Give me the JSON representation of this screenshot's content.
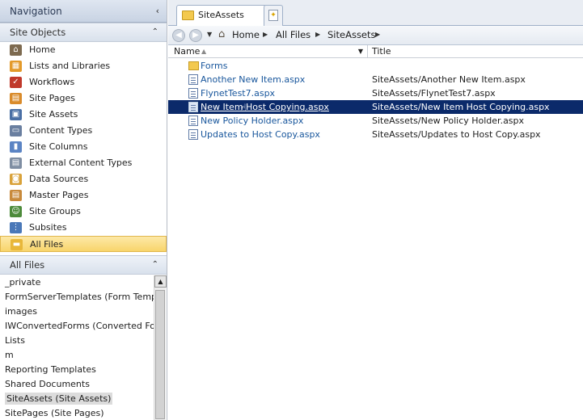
{
  "navigation": {
    "title": "Navigation",
    "collapse_glyph": "‹"
  },
  "site_objects": {
    "title": "Site Objects",
    "collapse_glyph": "⌃",
    "items": [
      {
        "label": "Home",
        "icon": "home-icon",
        "color": "#7d6a50",
        "glyph": "⌂"
      },
      {
        "label": "Lists and Libraries",
        "icon": "lists-icon",
        "color": "#e39a2a",
        "glyph": "▦"
      },
      {
        "label": "Workflows",
        "icon": "workflow-icon",
        "color": "#c0392b",
        "glyph": "✓"
      },
      {
        "label": "Site Pages",
        "icon": "site-pages-icon",
        "color": "#d98b2b",
        "glyph": "▤"
      },
      {
        "label": "Site Assets",
        "icon": "site-assets-icon",
        "color": "#4a6fa5",
        "glyph": "▣"
      },
      {
        "label": "Content Types",
        "icon": "content-types-icon",
        "color": "#6a7fa0",
        "glyph": "▭"
      },
      {
        "label": "Site Columns",
        "icon": "site-columns-icon",
        "color": "#5b84c4",
        "glyph": "▮"
      },
      {
        "label": "External Content Types",
        "icon": "external-content-types-icon",
        "color": "#7f8ea3",
        "glyph": "▤"
      },
      {
        "label": "Data Sources",
        "icon": "data-sources-icon",
        "color": "#d9a23a",
        "glyph": "◙"
      },
      {
        "label": "Master Pages",
        "icon": "master-pages-icon",
        "color": "#c88a3c",
        "glyph": "▤"
      },
      {
        "label": "Site Groups",
        "icon": "site-groups-icon",
        "color": "#4d8b3b",
        "glyph": "☺"
      },
      {
        "label": "Subsites",
        "icon": "subsites-icon",
        "color": "#4a78b8",
        "glyph": "⋮"
      },
      {
        "label": "All Files",
        "icon": "folder-icon",
        "color": "#e8b73a",
        "glyph": "▬"
      }
    ]
  },
  "all_files": {
    "title": "All Files",
    "collapse_glyph": "⌃",
    "items": [
      "_private",
      "FormServerTemplates (Form Templates)",
      "images",
      "IWConvertedForms (Converted Forms)",
      "Lists",
      "m",
      "Reporting Templates",
      "Shared Documents",
      "SiteAssets (Site Assets)",
      "SitePages (Site Pages)"
    ],
    "scroll_up": "▲"
  },
  "tabs": {
    "active": "SiteAssets",
    "new_tab_glyph": "✦"
  },
  "breadcrumb": {
    "back": "◀",
    "forward": "▶",
    "history": "▼",
    "home_glyph": "⌂",
    "items": [
      "Home",
      "All Files",
      "SiteAssets"
    ],
    "separator": "▶"
  },
  "columns": {
    "name": "Name",
    "title": "Title",
    "sort_glyph": "▲",
    "filter_glyph": "▼"
  },
  "files": [
    {
      "name": "Forms",
      "title": "",
      "type": "folder"
    },
    {
      "name": "Another New Item.aspx",
      "title": "SiteAssets/Another New Item.aspx",
      "type": "page"
    },
    {
      "name": "FlynetTest7.aspx",
      "title": "SiteAssets/FlynetTest7.aspx",
      "type": "page"
    },
    {
      "name": "New Item Host Copying.aspx",
      "title": "SiteAssets/New Item Host Copying.aspx",
      "type": "page"
    },
    {
      "name": "New Policy Holder.aspx",
      "title": "SiteAssets/New Policy Holder.aspx",
      "type": "page"
    },
    {
      "name": "Updates to Host Copy.aspx",
      "title": "SiteAssets/Updates to Host Copy.aspx",
      "type": "page"
    }
  ],
  "colors": {
    "selection_bg": "#0b2a6a",
    "link": "#18569c",
    "nav_selected": "#f8d46b"
  }
}
